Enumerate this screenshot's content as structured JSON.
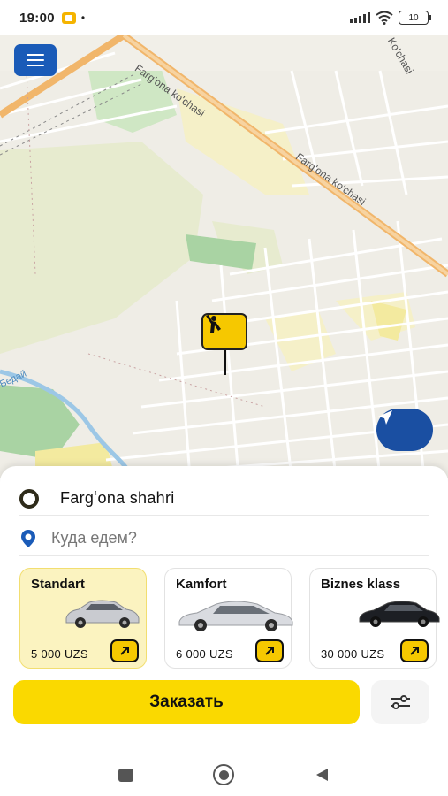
{
  "status_bar": {
    "time": "19:00",
    "battery": "10"
  },
  "map": {
    "street_labels": [
      "Farg'ona ko'chasi",
      "Farg'ona ko'chasi",
      "Ko'chasi",
      "Бедай"
    ],
    "colors": {
      "land": "#efede6",
      "park": "#cfe7c4",
      "residential": "#f5f0c8",
      "road_major": "#f1b66b",
      "water": "#9cc7e6"
    }
  },
  "icons": {
    "menu": "hamburger-icon",
    "pin": "hailing-person-icon",
    "locate": "navigation-arrow-icon",
    "pickup": "ring-icon",
    "destination": "location-pin-icon",
    "tariff_arrow": "arrow-up-right-icon",
    "filters": "sliders-icon"
  },
  "route": {
    "from": "Fargʻona shahri",
    "to_placeholder": "Куда едем?"
  },
  "tariffs": [
    {
      "name": "Standart",
      "price": "5 000 UZS",
      "selected": true,
      "car_color": "#c9cbd0"
    },
    {
      "name": "Kamfort",
      "price": "6 000 UZS",
      "selected": false,
      "car_color": "#d9dbe0"
    },
    {
      "name": "Biznes klass",
      "price": "30 000 UZS",
      "selected": false,
      "car_color": "#1d1f24"
    }
  ],
  "order_button": "Заказать",
  "colors": {
    "accent": "#fad900",
    "brand_blue": "#1a5bb8"
  }
}
